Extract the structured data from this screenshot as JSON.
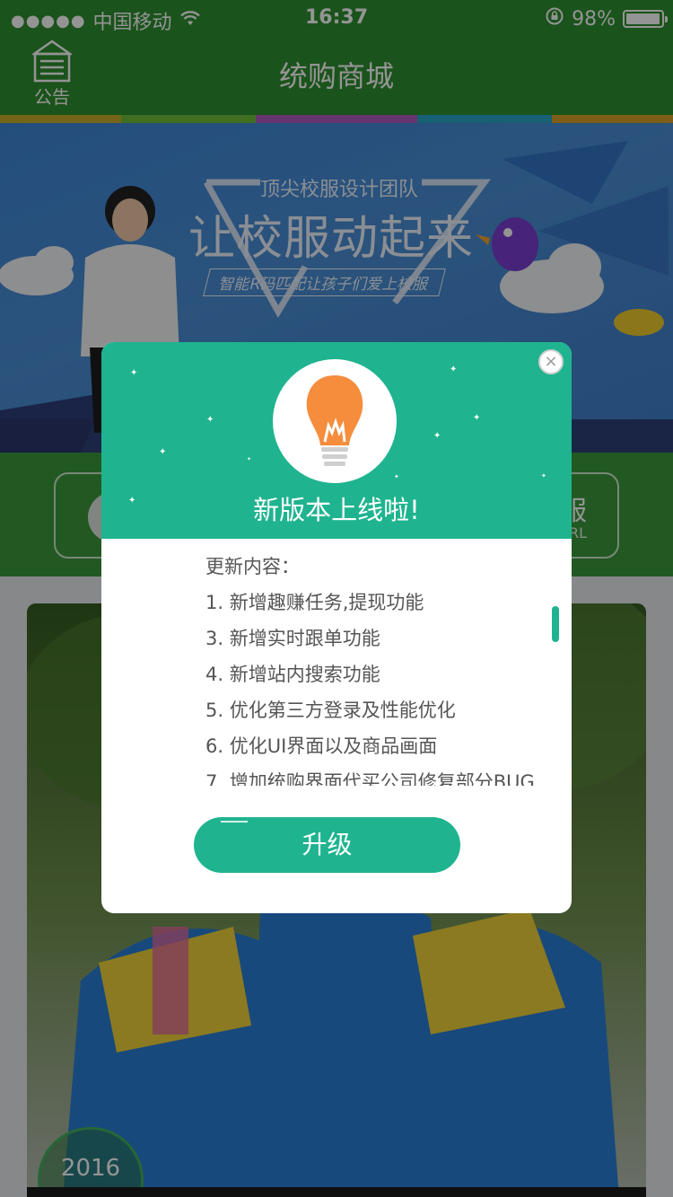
{
  "status_bar": {
    "signal_dots": "●●●●●",
    "carrier": "中国移动",
    "time": "16:37",
    "battery_percent": "98%",
    "battery_level": 0.98
  },
  "navbar": {
    "title": "统购商城",
    "notice_label": "公告"
  },
  "banner": {
    "subtitle": "顶尖校服设计团队",
    "headline": "让校服动起来",
    "slogan": "智能R码匹配让孩子们爱上校服"
  },
  "shortcuts": {
    "right_big": "服",
    "right_small": "RL"
  },
  "photo_card": {
    "year": "2016"
  },
  "modal": {
    "title": "新版本上线啦!",
    "changelog_heading": "更新内容：",
    "changelog_items": [
      "1. 新增趣赚任务,提现功能",
      "3. 新增实时跟单功能",
      "4. 新增站内搜索功能",
      "5. 优化第三方登录及性能优化",
      "6. 优化UI界面以及商品画面",
      "7. 增加统购界面代买公司修复部分BUG"
    ],
    "upgrade_label": "升级",
    "close_symbol": "×"
  },
  "colors": {
    "nav_green": "#2e8f2f",
    "modal_teal": "#1fb48f",
    "bulb_orange": "#f58d3d"
  }
}
